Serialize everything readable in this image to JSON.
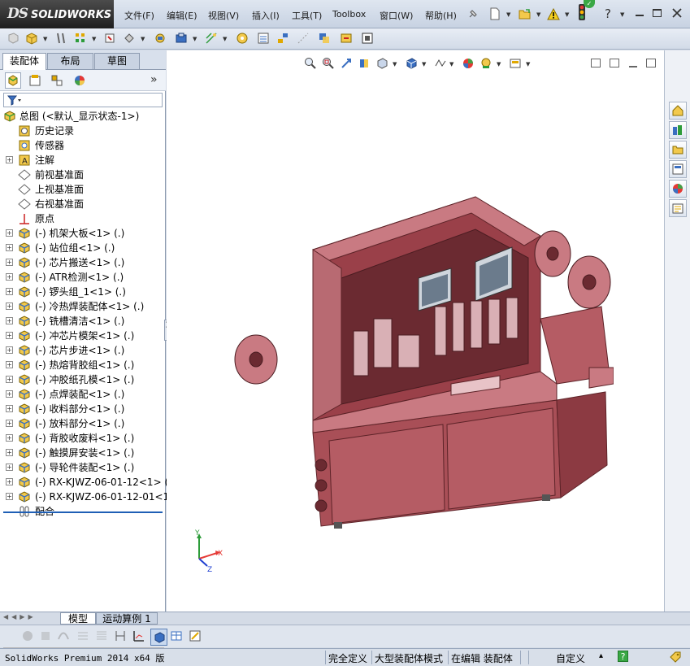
{
  "app": {
    "logo_mark": "DS",
    "logo_text": "SOLIDWORKS"
  },
  "menu": [
    "文件(F)",
    "编辑(E)",
    "视图(V)",
    "插入(I)",
    "工具(T)",
    "Toolbox",
    "窗口(W)",
    "帮助(H)"
  ],
  "help_icon_label": "?",
  "window_controls": [
    "minimize",
    "restore",
    "close"
  ],
  "left_tabs": [
    "装配体",
    "布局",
    "草图"
  ],
  "expand_label": "»",
  "tree": [
    {
      "label": "总图  (<默认_显示状态-1>)",
      "icon": "assembly-root-icon",
      "expand": false,
      "root": true
    },
    {
      "label": "历史记录",
      "icon": "history-icon",
      "expand": false
    },
    {
      "label": "传感器",
      "icon": "sensor-icon",
      "expand": false
    },
    {
      "label": "注解",
      "icon": "annotation-icon",
      "expand": true
    },
    {
      "label": "前视基准面",
      "icon": "plane-icon",
      "expand": false
    },
    {
      "label": "上视基准面",
      "icon": "plane-icon",
      "expand": false
    },
    {
      "label": "右视基准面",
      "icon": "plane-icon",
      "expand": false
    },
    {
      "label": "原点",
      "icon": "origin-icon",
      "expand": false
    },
    {
      "label": "(-) 机架大板<1> (.)",
      "icon": "subassembly-icon",
      "expand": true
    },
    {
      "label": "(-) 站位组<1> (.)",
      "icon": "subassembly-icon",
      "expand": true
    },
    {
      "label": "(-) 芯片搬送<1> (.)",
      "icon": "subassembly-icon",
      "expand": true
    },
    {
      "label": "(-) ATR检测<1> (.)",
      "icon": "subassembly-icon",
      "expand": true
    },
    {
      "label": "(-) 锣头组_1<1> (.)",
      "icon": "subassembly-icon",
      "expand": true
    },
    {
      "label": "(-) 冷热焊装配体<1> (.)",
      "icon": "subassembly-icon",
      "expand": true
    },
    {
      "label": "(-) 铣槽清洁<1> (.)",
      "icon": "subassembly-icon",
      "expand": true
    },
    {
      "label": "(-) 冲芯片模架<1> (.)",
      "icon": "subassembly-icon",
      "expand": true
    },
    {
      "label": "(-) 芯片步进<1> (.)",
      "icon": "subassembly-icon",
      "expand": true
    },
    {
      "label": "(-) 热熔背胶组<1> (.)",
      "icon": "subassembly-icon",
      "expand": true
    },
    {
      "label": "(-) 冲胶纸孔模<1> (.)",
      "icon": "subassembly-icon",
      "expand": true
    },
    {
      "label": "(-) 点焊装配<1> (.)",
      "icon": "subassembly-icon",
      "expand": true
    },
    {
      "label": "(-) 收料部分<1> (.)",
      "icon": "subassembly-icon",
      "expand": true
    },
    {
      "label": "(-) 放料部分<1> (.)",
      "icon": "subassembly-icon",
      "expand": true
    },
    {
      "label": "(-) 背胶收废料<1> (.)",
      "icon": "subassembly-icon",
      "expand": true
    },
    {
      "label": "(-) 触摸屏安装<1> (.)",
      "icon": "subassembly-icon",
      "expand": true
    },
    {
      "label": "(-) 导轮件装配<1> (.)",
      "icon": "subassembly-icon",
      "expand": true
    },
    {
      "label": "(-) RX-KJWZ-06-01-12<1> (A",
      "icon": "subassembly-icon",
      "expand": true
    },
    {
      "label": "(-) RX-KJWZ-06-01-12-01<1>",
      "icon": "subassembly-icon",
      "expand": true
    },
    {
      "label": "配合",
      "icon": "mates-icon",
      "expand": false
    }
  ],
  "bottom_tabs": [
    "模型",
    "运动算例 1"
  ],
  "status": {
    "product": "SolidWorks Premium 2014 x64 版",
    "constraint": "完全定义",
    "mode": "大型装配体模式",
    "editing": "在编辑 装配体",
    "units": "自定义",
    "units_arrow": "▴",
    "help_icon": "?"
  },
  "triad": {
    "x": "X",
    "y": "Y",
    "z": "Z"
  },
  "colors": {
    "model": "#a94f57",
    "model_light": "#c97a82",
    "model_dark": "#6b2a31",
    "accent": "#1f5fb5"
  }
}
